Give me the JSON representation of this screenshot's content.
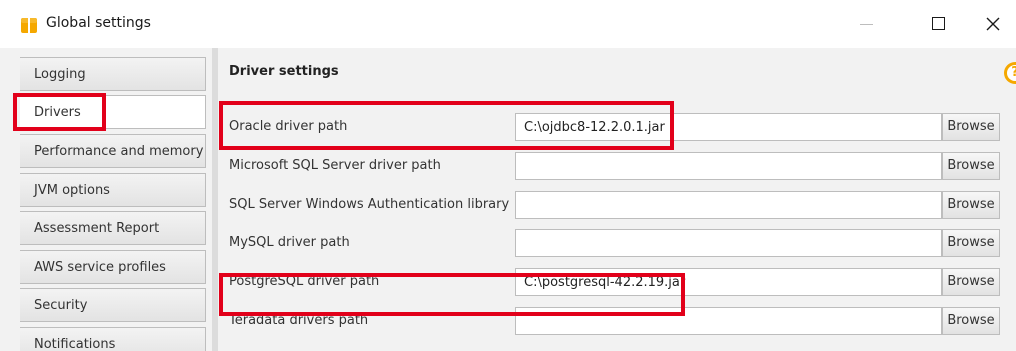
{
  "window": {
    "title": "Global settings",
    "accent_color": "#f5a800",
    "highlight_color": "#e2001a"
  },
  "sidebar": {
    "items": [
      {
        "label": "Logging"
      },
      {
        "label": "Drivers",
        "selected": true
      },
      {
        "label": "Performance and memory"
      },
      {
        "label": "JVM options"
      },
      {
        "label": "Assessment Report"
      },
      {
        "label": "AWS service profiles"
      },
      {
        "label": "Security"
      },
      {
        "label": "Notifications"
      }
    ]
  },
  "main": {
    "section_title": "Driver settings",
    "help_symbol": "?",
    "browse_label": "Browse",
    "rows": [
      {
        "label": "Oracle driver path",
        "value": "C:\\ojdbc8-12.2.0.1.jar"
      },
      {
        "label": "Microsoft SQL Server driver path",
        "value": ""
      },
      {
        "label": "SQL Server Windows Authentication library",
        "value": ""
      },
      {
        "label": "MySQL driver path",
        "value": ""
      },
      {
        "label": "PostgreSQL driver path",
        "value": "C:\\postgresql-42.2.19.jar"
      },
      {
        "label": "Teradata drivers path",
        "value": ""
      }
    ]
  }
}
